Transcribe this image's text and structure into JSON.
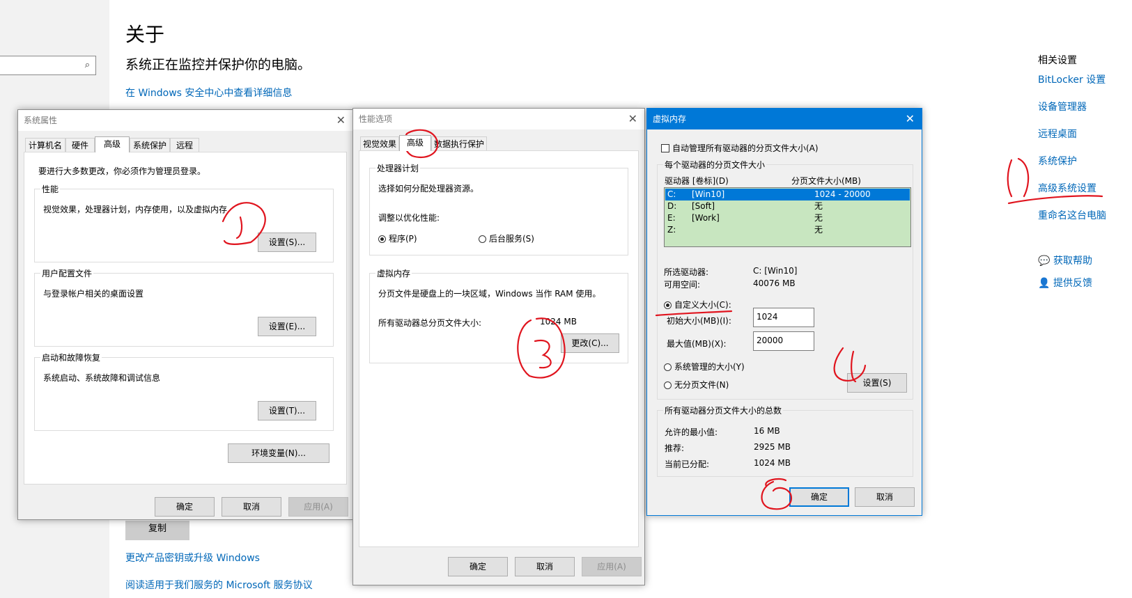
{
  "settings": {
    "search_icon": "search-icon",
    "title": "关于",
    "subtitle": "系统正在监控并保护你的电脑。",
    "security_link": "在 Windows 安全中心中查看详细信息",
    "copy_label": "复制",
    "change_key_link": "更改产品密钥或升级 Windows",
    "service_link": "阅读适用于我们服务的 Microsoft 服务协议",
    "related_title": "相关设置",
    "related_links": [
      "BitLocker 设置",
      "设备管理器",
      "远程桌面",
      "系统保护",
      "高级系统设置",
      "重命名这台电脑"
    ],
    "help_label": "获取帮助",
    "feedback_label": "提供反馈"
  },
  "system_properties": {
    "title": "系统属性",
    "close": "✕",
    "tabs": [
      "计算机名",
      "硬件",
      "高级",
      "系统保护",
      "远程"
    ],
    "admin_note": "要进行大多数更改，你必须作为管理员登录。",
    "perf": {
      "legend": "性能",
      "desc": "视觉效果，处理器计划，内存使用，以及虚拟内存",
      "button": "设置(S)..."
    },
    "profile": {
      "legend": "用户配置文件",
      "desc": "与登录帐户相关的桌面设置",
      "button": "设置(E)..."
    },
    "startup": {
      "legend": "启动和故障恢复",
      "desc": "系统启动、系统故障和调试信息",
      "button": "设置(T)..."
    },
    "env_button": "环境变量(N)...",
    "ok": "确定",
    "cancel": "取消",
    "apply": "应用(A)"
  },
  "performance_options": {
    "title": "性能选项",
    "close": "✕",
    "tabs": [
      "视觉效果",
      "高级",
      "数据执行保护"
    ],
    "cpu": {
      "legend": "处理器计划",
      "desc": "选择如何分配处理器资源。",
      "adjust": "调整以优化性能:",
      "programs": "程序(P)",
      "background": "后台服务(S)"
    },
    "vm": {
      "legend": "虚拟内存",
      "desc": "分页文件是硬盘上的一块区域，Windows 当作 RAM 使用。",
      "total_label": "所有驱动器总分页文件大小:",
      "total_value": "1024 MB",
      "change_button": "更改(C)..."
    },
    "ok": "确定",
    "cancel": "取消",
    "apply": "应用(A)"
  },
  "virtual_memory": {
    "title": "虚拟内存",
    "close": "✕",
    "auto_manage": "自动管理所有驱动器的分页文件大小(A)",
    "per_drive_legend": "每个驱动器的分页文件大小",
    "col_drive": "驱动器 [卷标](D)",
    "col_size": "分页文件大小(MB)",
    "drives": [
      {
        "letter": "C:",
        "label": "[Win10]",
        "size": "1024 - 20000"
      },
      {
        "letter": "D:",
        "label": "[Soft]",
        "size": "无"
      },
      {
        "letter": "E:",
        "label": "[Work]",
        "size": "无"
      },
      {
        "letter": "Z:",
        "label": "",
        "size": "无"
      }
    ],
    "selected_drive_label": "所选驱动器:",
    "selected_drive_value": "C:  [Win10]",
    "free_space_label": "可用空间:",
    "free_space_value": "40076 MB",
    "custom_size": "自定义大小(C):",
    "initial_label": "初始大小(MB)(I):",
    "initial_value": "1024",
    "max_label": "最大值(MB)(X):",
    "max_value": "20000",
    "system_managed": "系统管理的大小(Y)",
    "no_paging": "无分页文件(N)",
    "set_button": "设置(S)",
    "total_legend": "所有驱动器分页文件大小的总数",
    "min_label": "允许的最小值:",
    "min_value": "16 MB",
    "recommended_label": "推荐:",
    "recommended_value": "2925 MB",
    "current_label": "当前已分配:",
    "current_value": "1024 MB",
    "ok": "确定",
    "cancel": "取消"
  },
  "annotation_color": "#e0141e"
}
